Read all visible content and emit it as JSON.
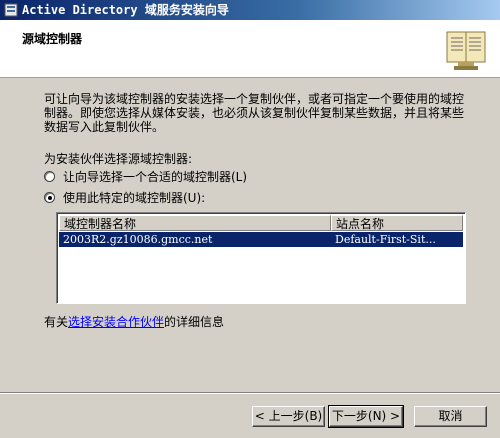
{
  "window": {
    "title": "Active Directory 域服务安装向导"
  },
  "header": {
    "title": "源域控制器",
    "icon": "book-icon"
  },
  "body": {
    "description": "可让向导为该域控制器的安装选择一个复制伙伴，或者可指定一个要使用的域控制器。即使您选择从媒体安装，也必须从该复制伙伴复制某些数据，并且将某些数据写入此复制伙伴。",
    "choose_label": "为安装伙伴选择源域控制器:",
    "options": [
      {
        "label": "让向导选择一个合适的域控制器(L)",
        "selected": false
      },
      {
        "label": "使用此特定的域控制器(U):",
        "selected": true
      }
    ],
    "list": {
      "columns": [
        "域控制器名称",
        "站点名称"
      ],
      "rows": [
        {
          "name": "2003R2.gz10086.gmcc.net",
          "site": "Default-First-Sit...",
          "selected": true
        }
      ]
    },
    "more_info_prefix": "有关",
    "more_info_link": "选择安装合作伙伴",
    "more_info_suffix": "的详细信息"
  },
  "buttons": {
    "back": "< 上一步(B)",
    "next": "下一步(N) >",
    "cancel": "取消"
  },
  "colors": {
    "titlebar": "#0a246a",
    "selection": "#0a246a",
    "link": "#0000ff",
    "face": "#d4d0c8"
  }
}
